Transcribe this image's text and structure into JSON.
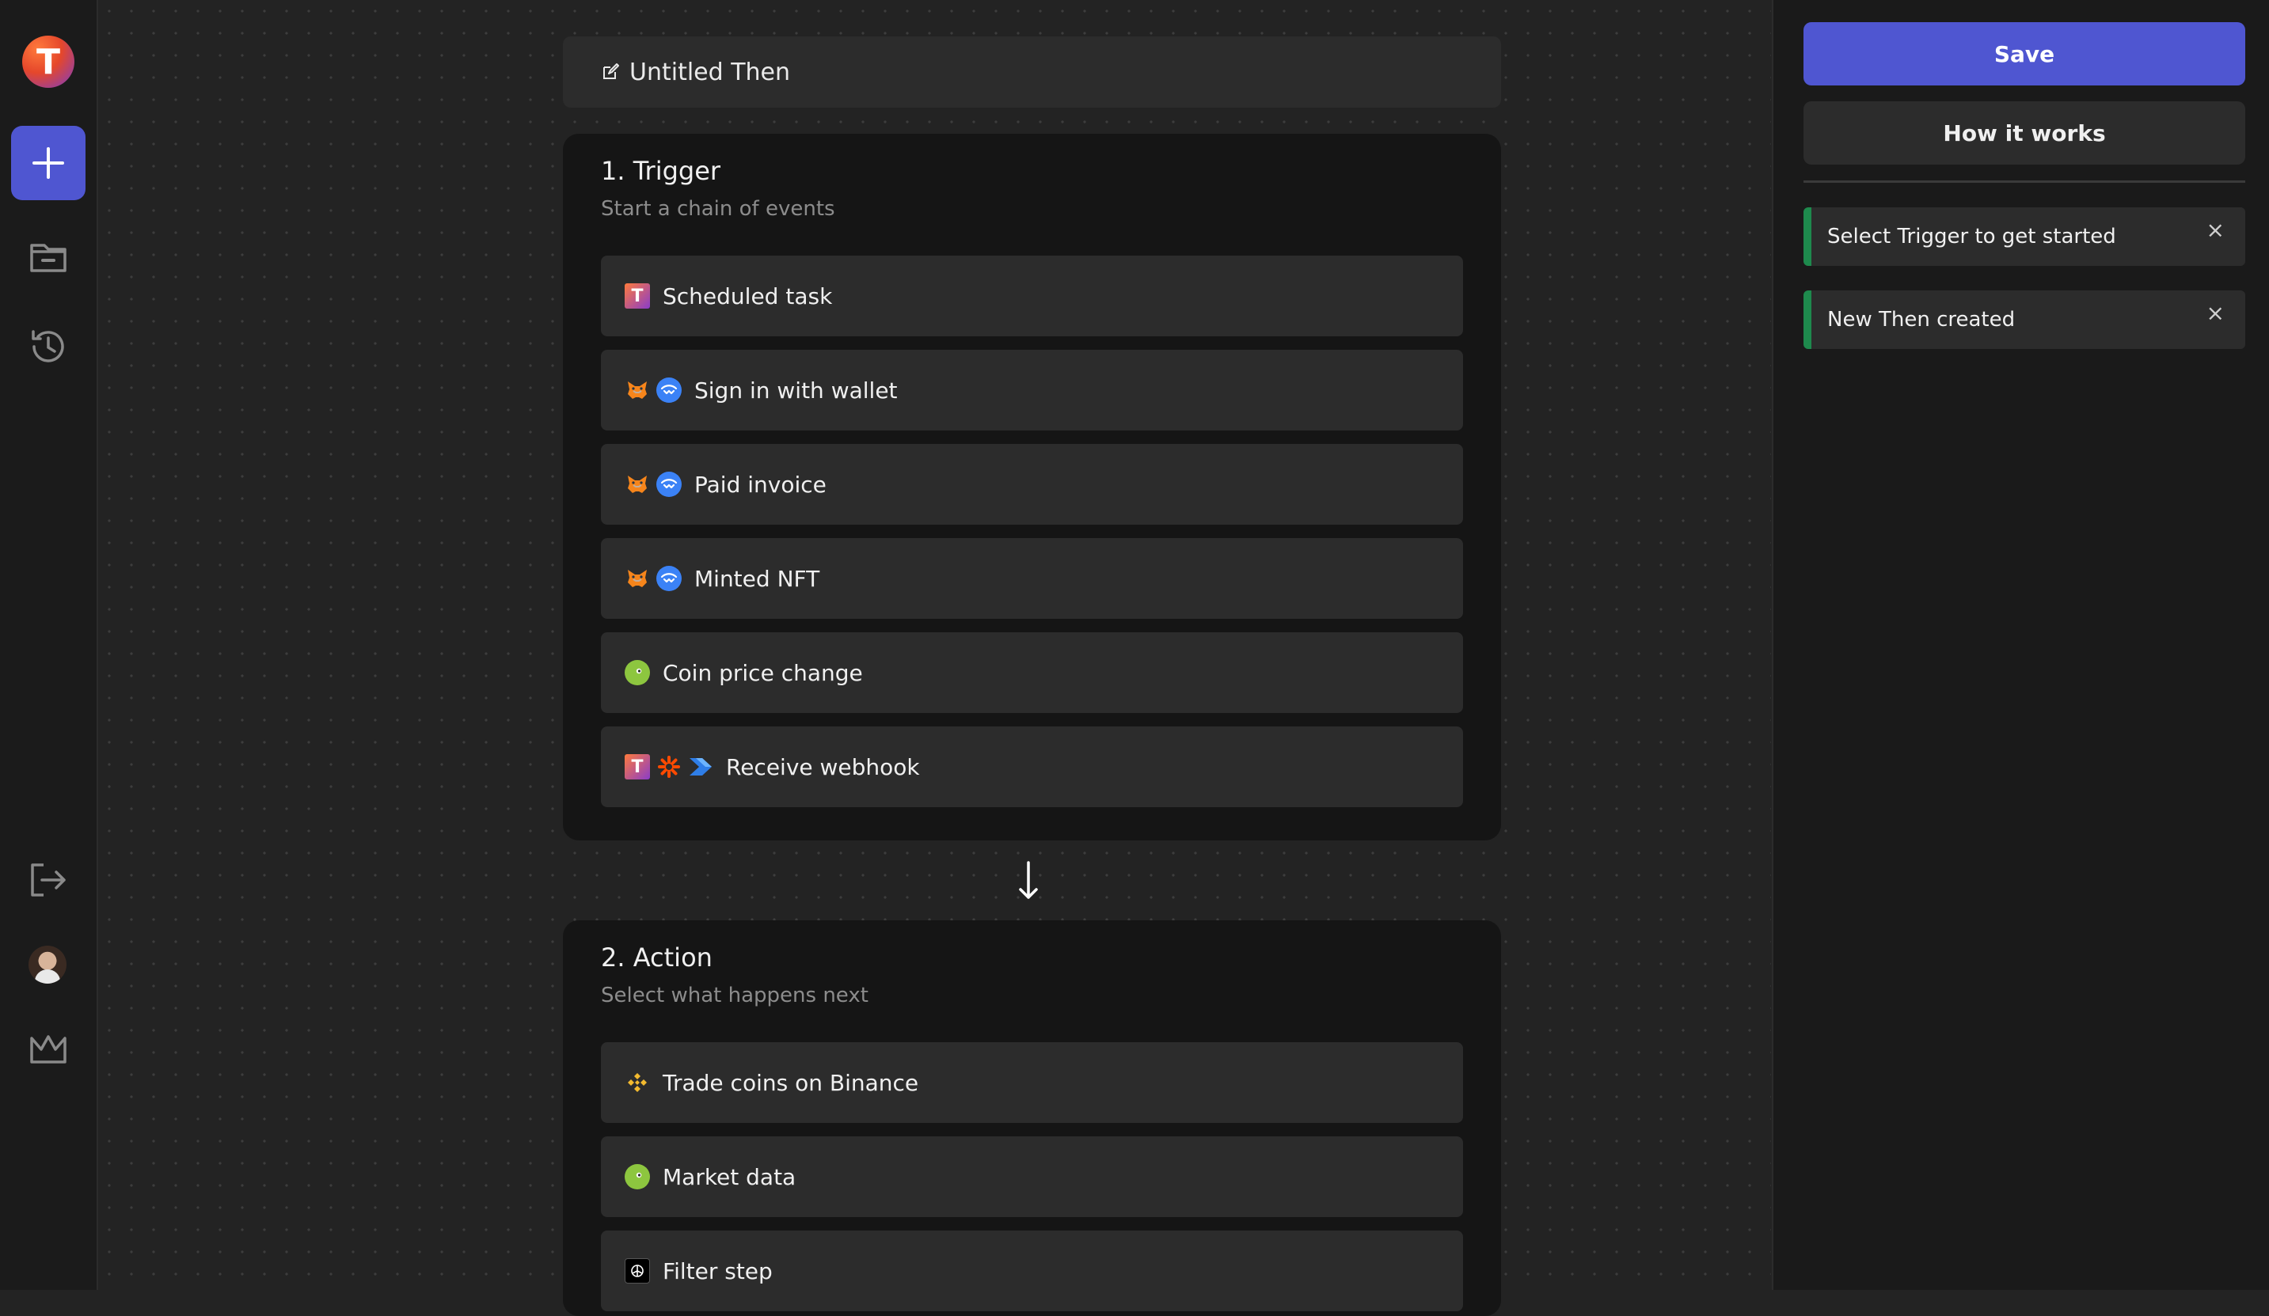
{
  "app": {
    "logo_letter": "T"
  },
  "rail": {
    "icons": [
      "plus-icon",
      "folder-icon",
      "history-icon",
      "logout-icon",
      "avatar",
      "crown-icon"
    ]
  },
  "canvas": {
    "title": "Untitled Then",
    "trigger": {
      "heading": "1. Trigger",
      "subtitle": "Start a chain of events",
      "items": [
        {
          "label": "Scheduled task",
          "icons": [
            "t-logo-icon"
          ]
        },
        {
          "label": "Sign in with wallet",
          "icons": [
            "metamask-icon",
            "walletconnect-icon"
          ]
        },
        {
          "label": "Paid invoice",
          "icons": [
            "metamask-icon",
            "walletconnect-icon"
          ]
        },
        {
          "label": "Minted NFT",
          "icons": [
            "metamask-icon",
            "walletconnect-icon"
          ]
        },
        {
          "label": "Coin price change",
          "icons": [
            "coingecko-icon"
          ]
        },
        {
          "label": "Receive webhook",
          "icons": [
            "t-logo-icon",
            "zapier-icon",
            "power-automate-icon"
          ]
        }
      ]
    },
    "action": {
      "heading": "2. Action",
      "subtitle": "Select what happens next",
      "items": [
        {
          "label": "Trade coins on Binance",
          "icons": [
            "binance-icon"
          ]
        },
        {
          "label": "Market data",
          "icons": [
            "coingecko-icon"
          ]
        },
        {
          "label": "Filter step",
          "icons": [
            "openai-icon"
          ]
        }
      ]
    }
  },
  "panel": {
    "save_label": "Save",
    "how_label": "How it works",
    "toasts": [
      {
        "text": "Select Trigger to get started",
        "close": "×"
      },
      {
        "text": "New Then created",
        "close": "×"
      }
    ]
  },
  "colors": {
    "accent": "#4f56d1",
    "success": "#1e8a4d",
    "panel": "#2c2c2c"
  }
}
